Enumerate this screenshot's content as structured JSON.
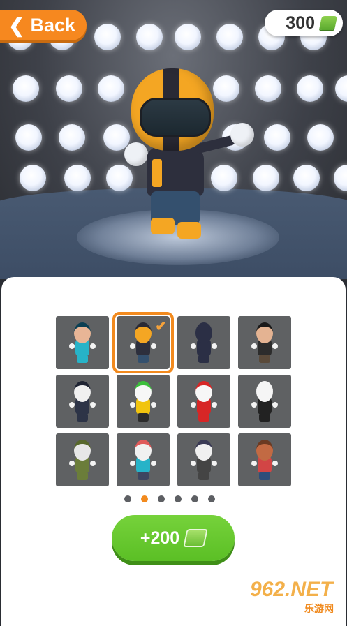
{
  "header": {
    "back_label": "Back",
    "coins": "300",
    "back_icon": "chevron-left-icon",
    "coin_icon": "cash-icon"
  },
  "colors": {
    "accent": "#f28a1e",
    "buy_green": "#5bbf25",
    "tile_bg": "#5f6163"
  },
  "skins": [
    {
      "name": "genie",
      "head": "#e8b596",
      "body": "#27b3c8",
      "legs": "#27b3c8",
      "hat": "#0b3f53",
      "selected": false
    },
    {
      "name": "biker",
      "head": "#f4a623",
      "body": "#2d2f3d",
      "legs": "#34506e",
      "hat": "#2a2a35",
      "selected": true
    },
    {
      "name": "ninja",
      "head": "#2b2f45",
      "body": "#2b2f45",
      "legs": "#2b2f45",
      "hat": "#2b2f45",
      "selected": false
    },
    {
      "name": "pirate",
      "head": "#e4b392",
      "body": "#2c2c2c",
      "legs": "#5a4a3a",
      "hat": "#1a1a1a",
      "selected": false
    },
    {
      "name": "police",
      "head": "#f0f0f0",
      "body": "#2d3447",
      "legs": "#2d3447",
      "hat": "#1f2433",
      "selected": false
    },
    {
      "name": "sprout",
      "head": "#f7f7f7",
      "body": "#f1c40f",
      "legs": "#2c2c2c",
      "hat": "#3cbf3c",
      "selected": false
    },
    {
      "name": "santa",
      "head": "#f7f7f7",
      "body": "#d72626",
      "legs": "#d72626",
      "hat": "#d72626",
      "selected": false
    },
    {
      "name": "skeleton",
      "head": "#f5f5f5",
      "body": "#222",
      "legs": "#222",
      "hat": "#f5f5f5",
      "selected": false
    },
    {
      "name": "soldier",
      "head": "#e7e7e7",
      "body": "#6b7d3a",
      "legs": "#6b7d3a",
      "hat": "#58682c",
      "selected": false
    },
    {
      "name": "zombie",
      "head": "#f1f1f1",
      "body": "#27b3c8",
      "legs": "#3d4660",
      "hat": "#e05a5a",
      "selected": false
    },
    {
      "name": "robber",
      "head": "#f0f0f0",
      "body": "#444",
      "legs": "#444",
      "hat": "#3a3a55",
      "selected": false
    },
    {
      "name": "kid",
      "head": "#c26a43",
      "body": "#d24545",
      "legs": "#2f4d7a",
      "hat": "#6b3a22",
      "selected": false
    }
  ],
  "pagination": {
    "pages": 6,
    "active": 2
  },
  "buy": {
    "label": "+200",
    "icon": "cash-icon"
  },
  "watermark": {
    "main": "962.NET",
    "sub": "乐游网"
  }
}
